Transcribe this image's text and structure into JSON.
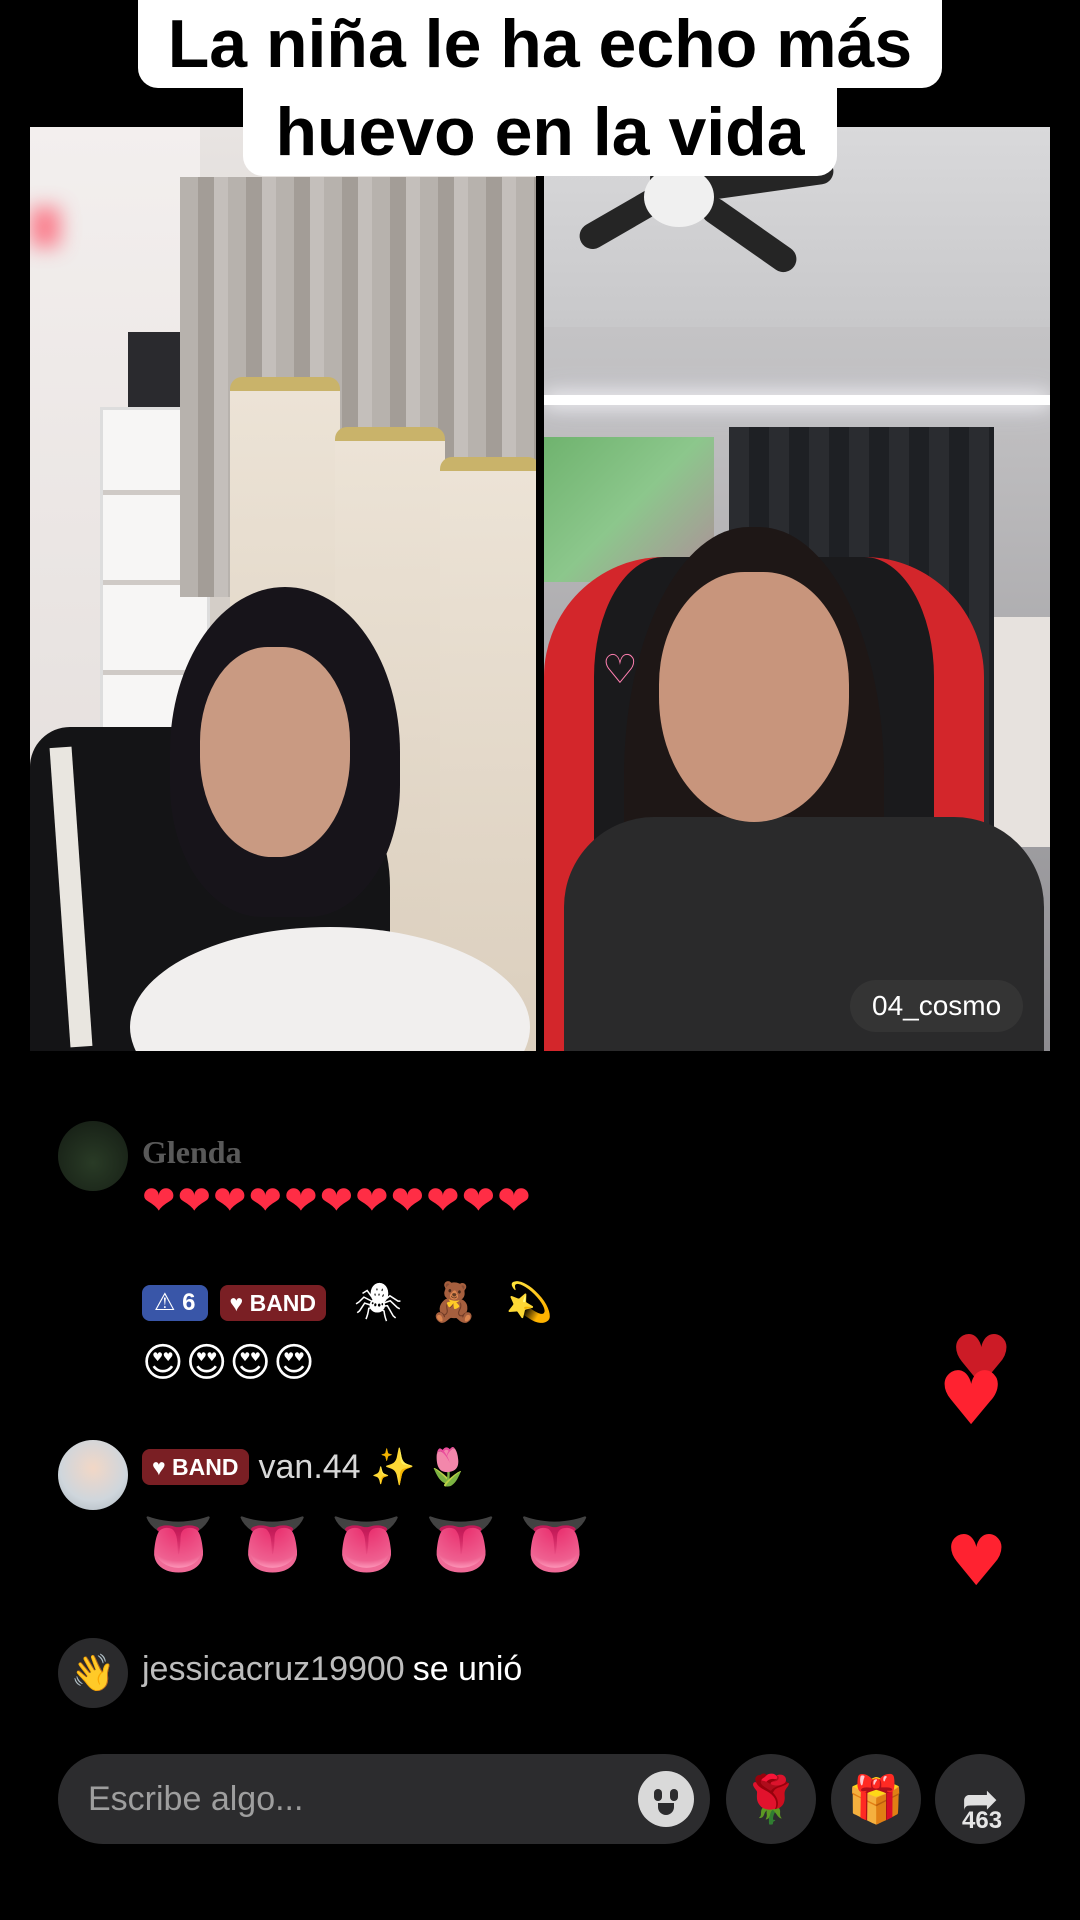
{
  "caption": {
    "line1": "La niña le ha echo más",
    "line2": "huevo en la vida"
  },
  "video": {
    "right_username": "04_cosmo"
  },
  "chat": {
    "messages": [
      {
        "user": "Glenda",
        "content": "❤❤❤❤❤❤❤❤❤❤❤"
      },
      {
        "level_badge": "⚠ 6",
        "band_badge": "♥ BAND",
        "badge_emojis": [
          "🕷",
          "🧸",
          "💫"
        ],
        "content": "😍😍😍😍"
      },
      {
        "band_badge": "♥ BAND",
        "user": "van.44",
        "user_emojis": [
          "✨",
          "🌷"
        ],
        "content": "👅👅👅👅👅"
      }
    ],
    "join_event": {
      "user": "jessicacruz19900",
      "text": "se unió"
    }
  },
  "bottom_bar": {
    "input_placeholder": "Escribe algo...",
    "emoji_icon": "smiley-icon",
    "rose_icon": "🌹",
    "gift_icon": "🎁",
    "share_icon": "➦",
    "share_count": "463"
  },
  "colors": {
    "background": "#000000",
    "level_badge": "#3956a8",
    "band_badge": "#7a1f24",
    "heart": "#ff2230"
  }
}
